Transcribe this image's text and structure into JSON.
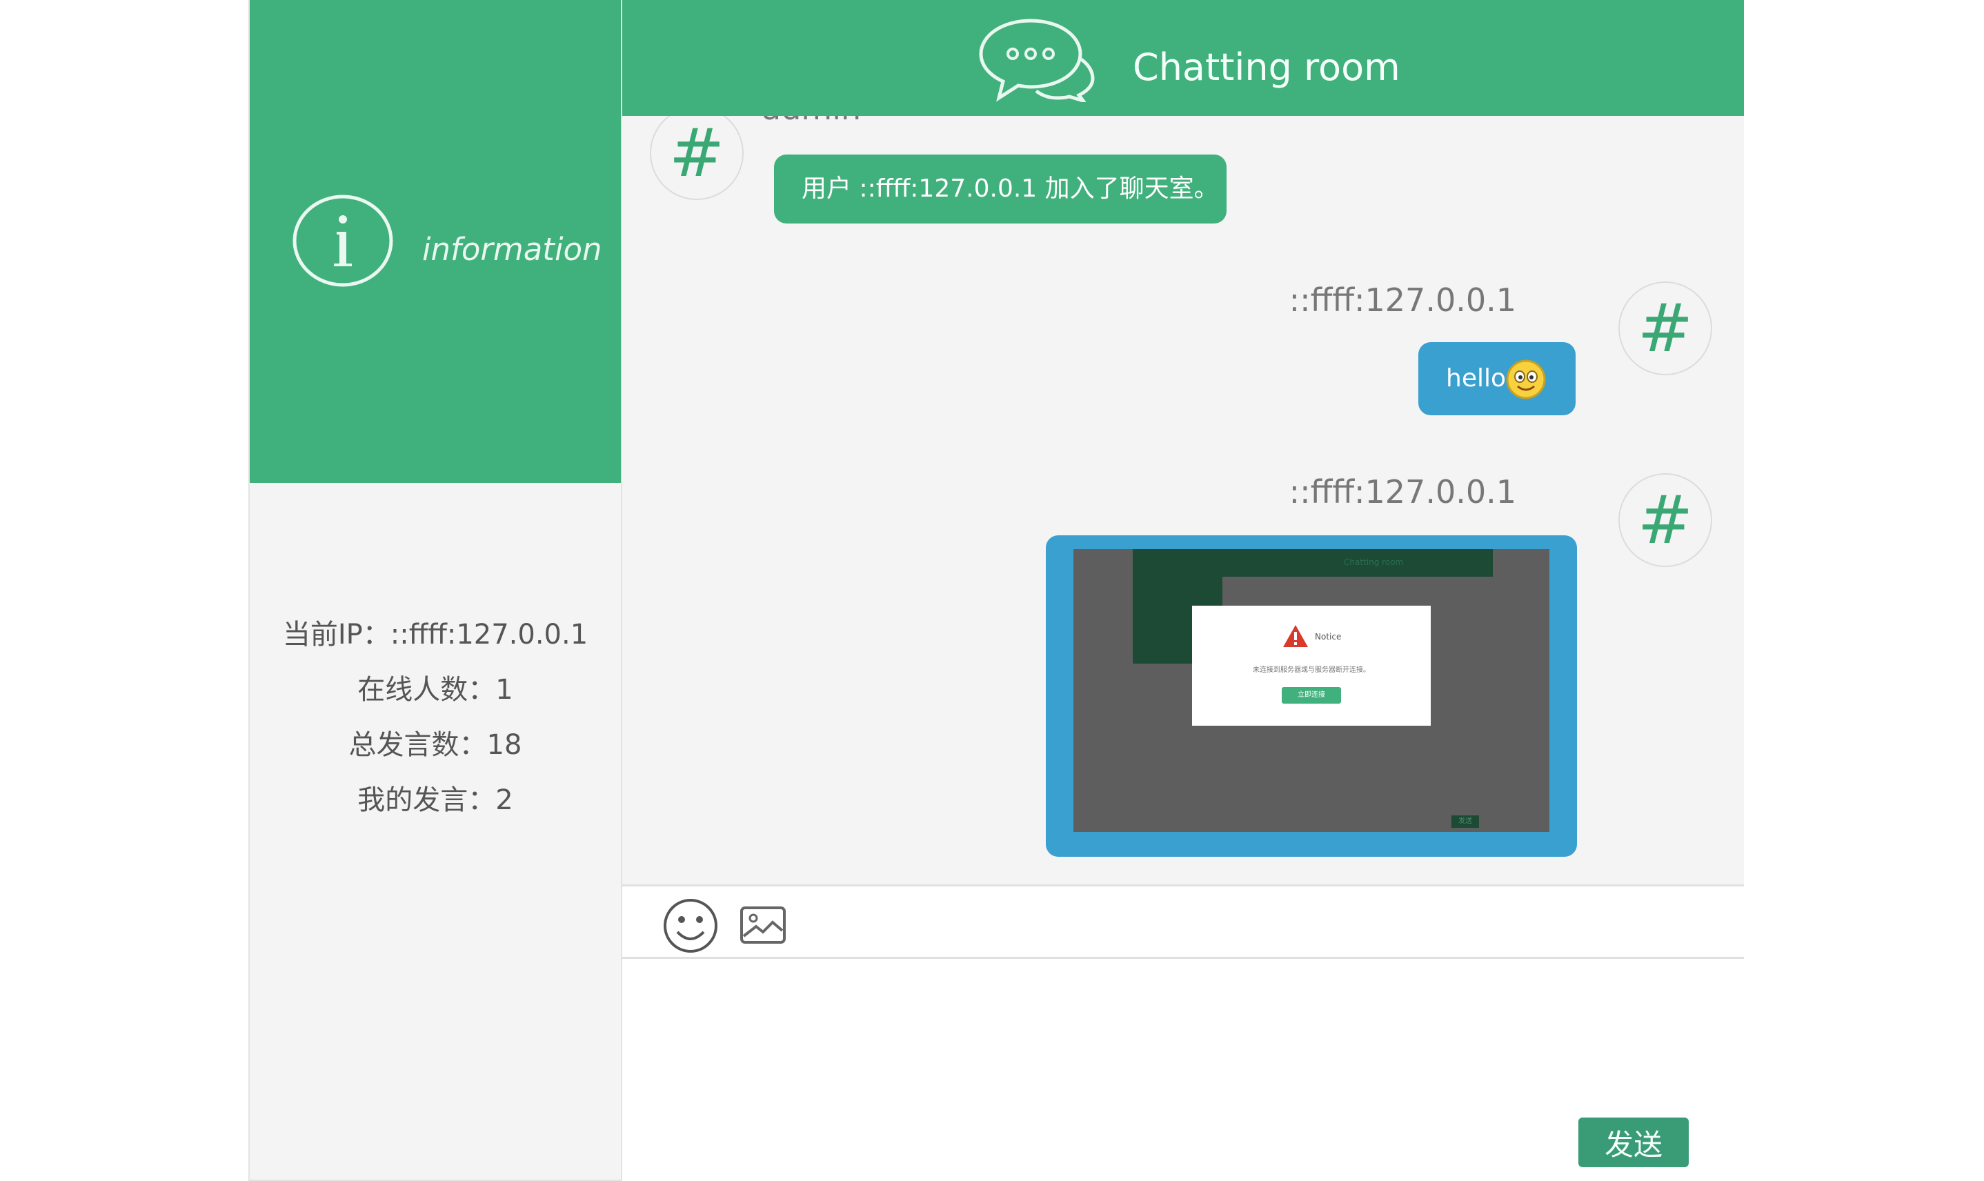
{
  "sidebar": {
    "info_label": "information",
    "stats": [
      {
        "label": "当前IP：",
        "value": "::ffff:127.0.0.1"
      },
      {
        "label": "在线人数：",
        "value": "1"
      },
      {
        "label": "总发言数：",
        "value": "18"
      },
      {
        "label": "我的发言：",
        "value": "2"
      }
    ]
  },
  "header": {
    "title": "Chatting room",
    "icon": "chat-bubbles-icon"
  },
  "messages": [
    {
      "sender": "admin",
      "avatar": "#",
      "text": "用户 ::ffff:127.0.0.1 加入了聊天室。",
      "side": "left"
    },
    {
      "sender": "::ffff:127.0.0.1",
      "avatar": "#",
      "text": "hello",
      "emoji": "smiling-face-emoji",
      "side": "right"
    },
    {
      "sender": "::ffff:127.0.0.1",
      "avatar": "#",
      "attachment": "screenshot-image",
      "side": "right",
      "thumbnail": {
        "title": "Chatting room",
        "notice_title": "Notice",
        "notice_text": "未连接到服务器或与服务器断开连接。",
        "notice_button": "立即连接",
        "send": "发送"
      }
    }
  ],
  "toolbar": {
    "emoji_icon": "smiley-icon",
    "image_icon": "image-icon"
  },
  "composer": {
    "value": "",
    "send_label": "发送"
  },
  "colors": {
    "brand": "#40b07c",
    "bubble_blue": "#3aa0d0",
    "send": "#3a9c77",
    "background": "#f4f4f4"
  }
}
